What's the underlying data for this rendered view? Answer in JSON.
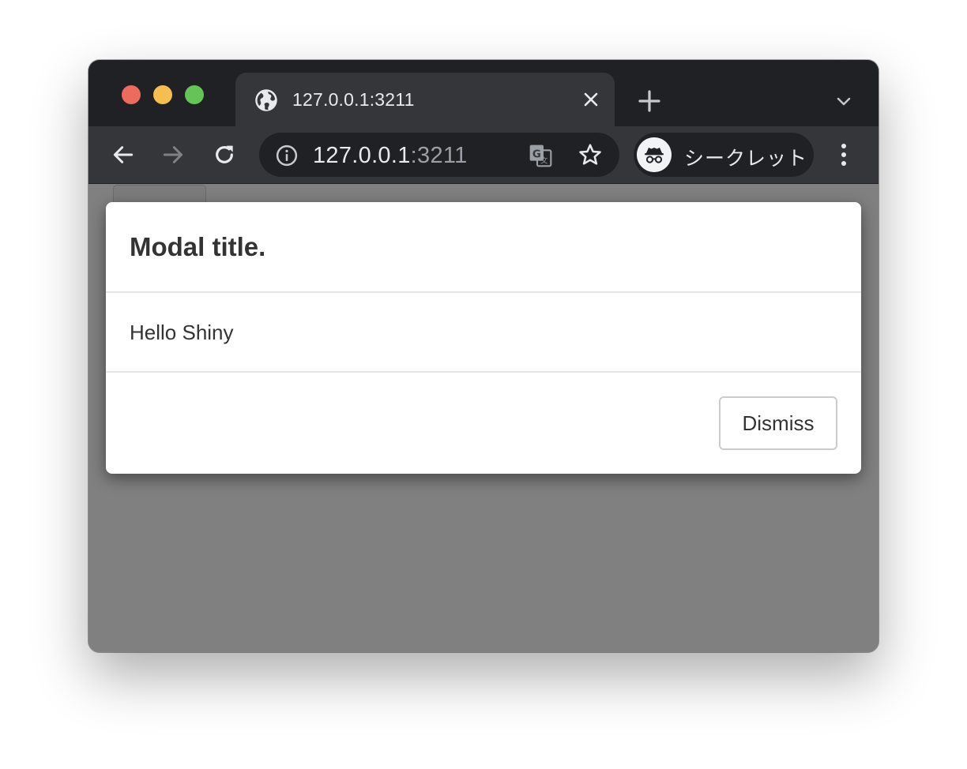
{
  "browser": {
    "tab": {
      "title": "127.0.0.1:3211",
      "icon": "globe-icon"
    },
    "address_bar": {
      "host": "127.0.0.1",
      "port": ":3211",
      "info_icon": "info-icon",
      "translate_icon": "translate-icon",
      "bookmark_icon": "star-icon"
    },
    "profile": {
      "label": "シークレット",
      "icon": "incognito-icon"
    },
    "colors": {
      "frame": "#202124",
      "toolbar": "#35363a",
      "text": "#e8eaed"
    }
  },
  "modal": {
    "title": "Modal title.",
    "body": "Hello Shiny",
    "dismiss_label": "Dismiss"
  },
  "page": {
    "backdrop_color": "#808080"
  }
}
